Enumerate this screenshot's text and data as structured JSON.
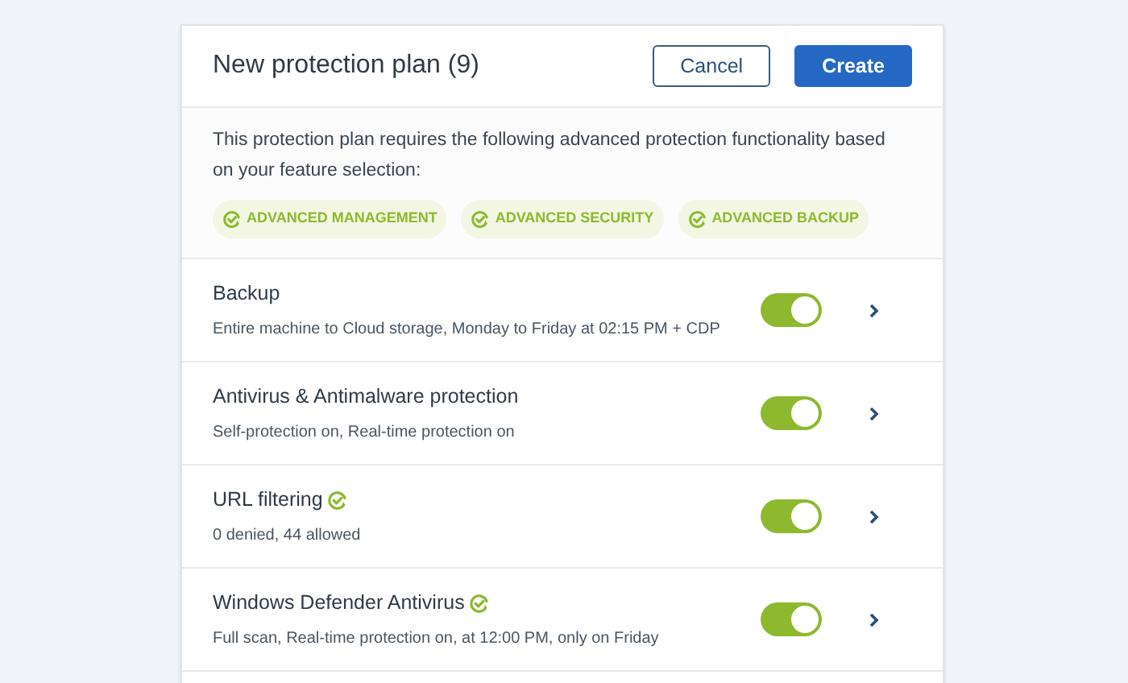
{
  "header": {
    "title": "New protection plan (9)",
    "buttons": [
      {
        "label": "Cancel",
        "kind": "secondary"
      },
      {
        "label": "Create",
        "kind": "primary"
      }
    ]
  },
  "notice": {
    "text": "This protection plan requires the following advanced protection functionality based on your feature selection:",
    "tags": [
      "ADVANCED MANAGEMENT",
      "ADVANCED SECURITY",
      "ADVANCED BACKUP"
    ]
  },
  "modules": [
    {
      "name": "Backup",
      "summary": "Entire machine to Cloud storage, Monday to Friday at 02:15 PM + CDP",
      "advanced": false,
      "on": true
    },
    {
      "name": "Antivirus & Antimalware protection",
      "summary": "Self-protection on, Real-time protection on",
      "advanced": false,
      "on": true
    },
    {
      "name": "URL filtering",
      "summary": "0 denied, 44 allowed",
      "advanced": true,
      "on": true
    },
    {
      "name": "Windows Defender Antivirus",
      "summary": "Full scan, Real-time protection on, at 12:00 PM, only on Friday",
      "advanced": true,
      "on": true
    }
  ]
}
